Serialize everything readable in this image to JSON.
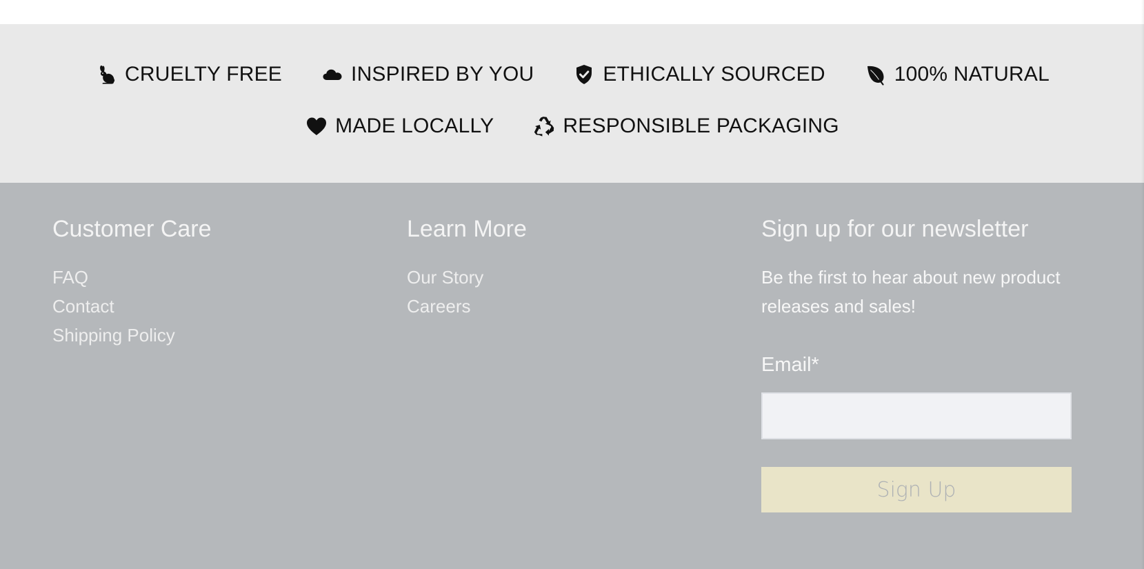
{
  "features": [
    {
      "label": "CRUELTY FREE",
      "icon": "rabbit-icon"
    },
    {
      "label": "INSPIRED BY YOU",
      "icon": "cloud-icon"
    },
    {
      "label": "ETHICALLY SOURCED",
      "icon": "shield-check-icon"
    },
    {
      "label": "100% NATURAL",
      "icon": "leaf-icon"
    },
    {
      "label": "MADE LOCALLY",
      "icon": "heart-icon"
    },
    {
      "label": "RESPONSIBLE PACKAGING",
      "icon": "recycle-icon"
    }
  ],
  "customer_care": {
    "title": "Customer Care",
    "links": [
      "FAQ",
      "Contact",
      "Shipping Policy"
    ]
  },
  "learn_more": {
    "title": "Learn More",
    "links": [
      "Our Story",
      "Careers"
    ]
  },
  "newsletter": {
    "title": "Sign up for our newsletter",
    "description": "Be the first to hear about new product releases and sales!",
    "email_label": "Email*",
    "email_value": "",
    "button_label": "Sign Up"
  },
  "colors": {
    "features_bg": "#e9e9e9",
    "footer_bg": "#b5b8bb",
    "button_bg": "#e9e4c8",
    "input_bg": "#f1f2f5"
  }
}
